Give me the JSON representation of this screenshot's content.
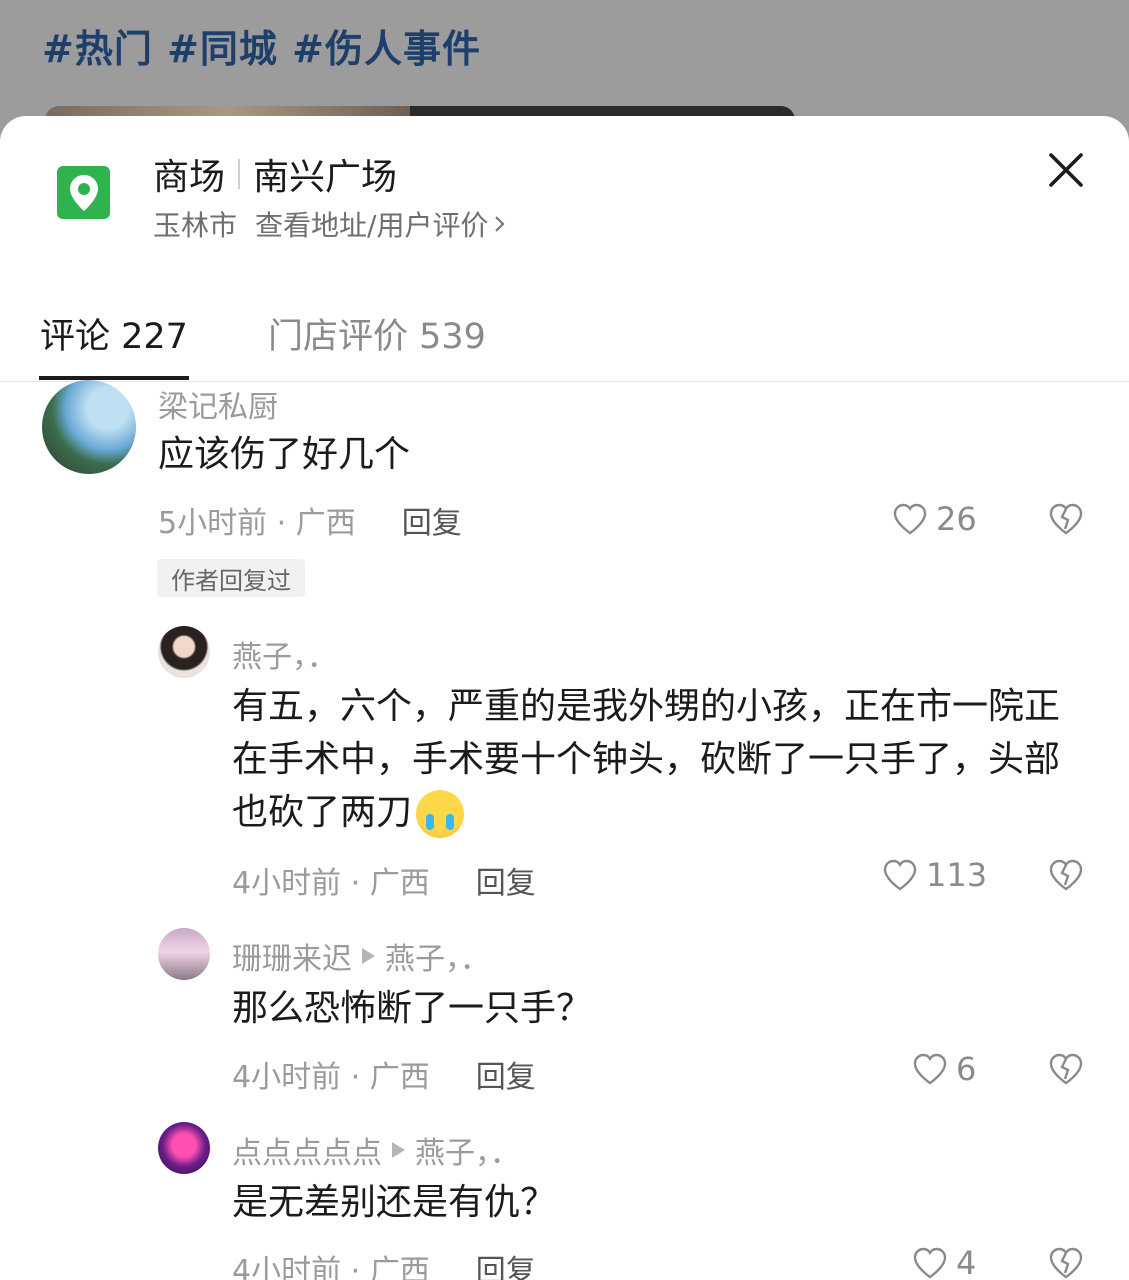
{
  "background": {
    "hashtags": "#热门 #同城 #伤人事件"
  },
  "location": {
    "category": "商场",
    "name": "南兴广场",
    "city": "玉林市",
    "link_label": "查看地址/用户评价"
  },
  "tabs": [
    {
      "label": "评论 227",
      "active": true
    },
    {
      "label": "门店评价 539",
      "active": false
    }
  ],
  "comments": [
    {
      "user": "梁记私厨",
      "text": "应该伤了好几个",
      "time_region": "5小时前 · 广西",
      "reply_label": "回复",
      "likes": "26",
      "author_tag": "作者回复过"
    },
    {
      "user": "燕子，．",
      "text": "有五，六个，严重的是我外甥的小孩，正在市一院正在手术中，手术要十个钟头，砍断了一只手了，头部也砍了两刀",
      "emoji": "crying-face",
      "time_region": "4小时前 · 广西",
      "reply_label": "回复",
      "likes": "113"
    },
    {
      "user": "珊珊来迟",
      "reply_to": "燕子，．",
      "text": "那么恐怖断了一只手？",
      "time_region": "4小时前 · 广西",
      "reply_label": "回复",
      "likes": "6"
    },
    {
      "user": "点点点点点",
      "reply_to": "燕子，．",
      "text": "是无差别还是有仇？",
      "time_region": "4小时前 · 广西",
      "reply_label": "回复",
      "likes": "4"
    }
  ],
  "colors": {
    "accent_green": "#2fb34f",
    "backdrop": "#9c9c9c",
    "hashtag_blue": "#1f3f6b"
  }
}
